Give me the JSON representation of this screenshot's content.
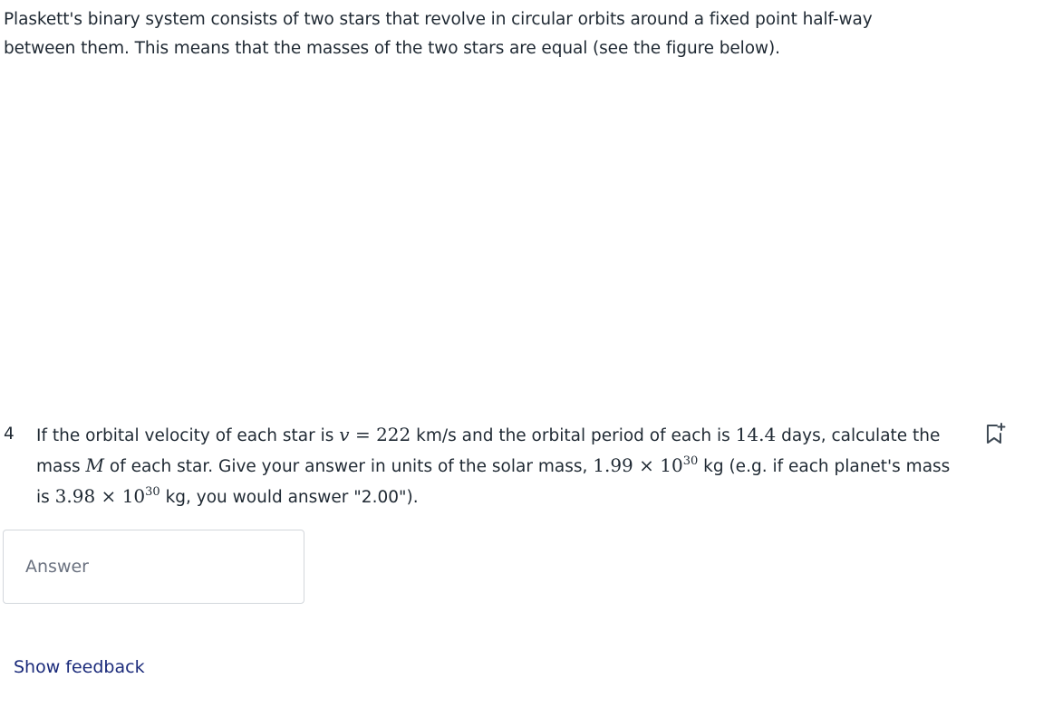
{
  "intro": {
    "text": "Plaskett's binary system consists of two stars that revolve in circular orbits around a fixed point half-way between them. This means that the masses of the two stars are equal (see the figure below)."
  },
  "question": {
    "number": "4",
    "part1": "If the orbital velocity of each star is ",
    "v_symbol": "v",
    "v_equals": " = ",
    "v_value": "222",
    "part2": " km/s and the orbital period of each is ",
    "period_value": "14.4",
    "part3": " days, calculate the mass ",
    "mass_symbol": "M",
    "part4": " of each star. Give your answer in units of the solar mass, ",
    "solar_mantissa": "1.99",
    "times1": " × ",
    "base1": "10",
    "exp1": "30",
    "part5": " kg (e.g. if each planet's mass is ",
    "example_mantissa": "3.98",
    "times2": " × ",
    "base2": "10",
    "exp2": "30",
    "part6": " kg, you would answer \"2.00\")."
  },
  "answer": {
    "placeholder": "Answer",
    "value": ""
  },
  "feedback": {
    "label": "Show feedback"
  },
  "icons": {
    "bookmark": "bookmark-add-icon"
  },
  "colors": {
    "link": "#1a2a7a",
    "text": "#1f2933",
    "border": "#d3d7dc"
  }
}
